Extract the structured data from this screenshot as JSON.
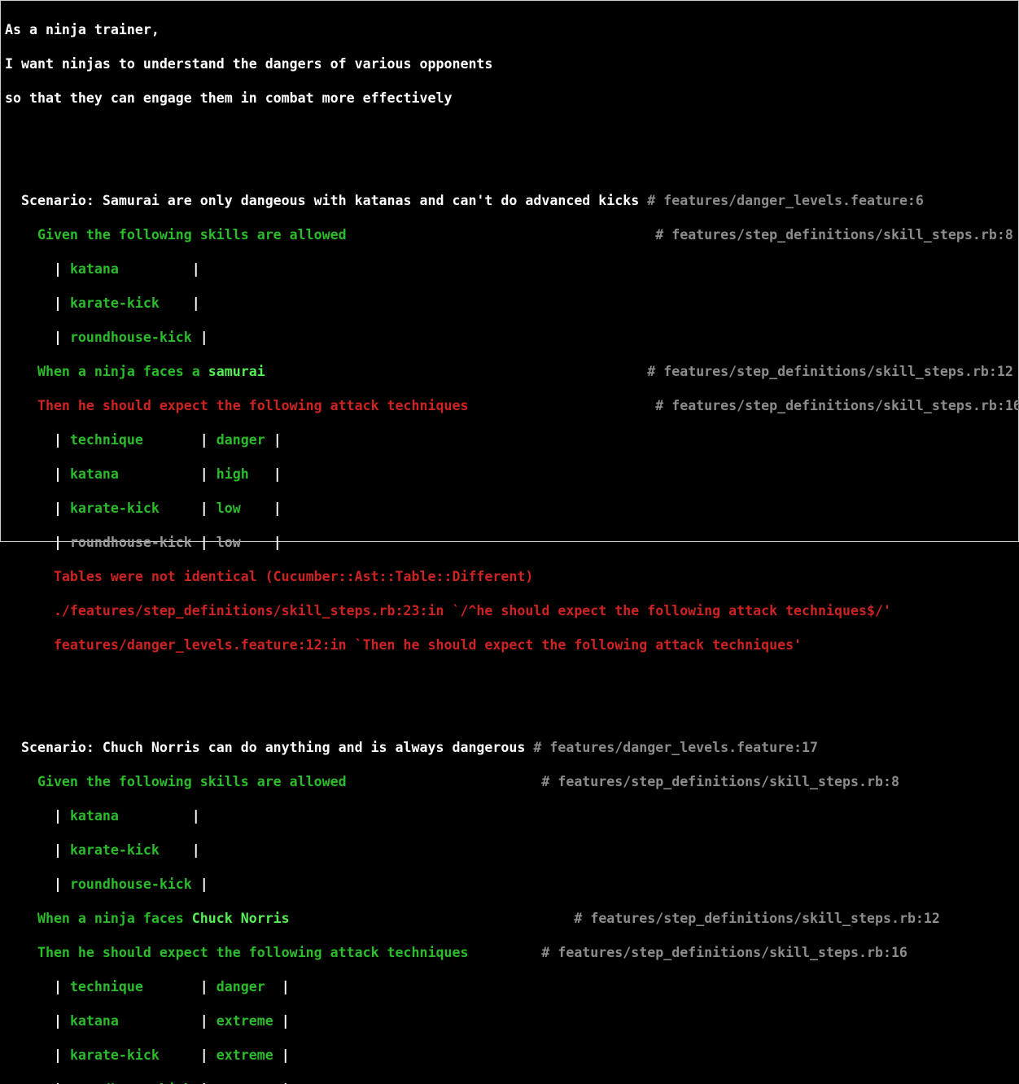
{
  "colors": {
    "background": "#000000",
    "text": "#ffffff",
    "passed": "#2bbb2b",
    "passed_arg": "#55ee55",
    "failed": "#cd2323",
    "comment": "#8c8c8c",
    "skipped": "#9a9a9a"
  },
  "feature": {
    "narrative": [
      "As a ninja trainer,",
      "I want ninjas to understand the dangers of various opponents",
      "so that they can engage them in combat more effectively"
    ]
  },
  "scenario1": {
    "title": "  Scenario: Samurai are only dangeous with katanas and can't do advanced kicks",
    "title_comment": " # features/danger_levels.feature:6",
    "given": "    Given the following skills are allowed                                      ",
    "given_comment": "# features/step_definitions/skill_steps.rb:8",
    "skills_table": [
      {
        "indent": "      ",
        "open": "| ",
        "cell": "katana        ",
        "close": " |"
      },
      {
        "indent": "      ",
        "open": "| ",
        "cell": "karate-kick   ",
        "close": " |"
      },
      {
        "indent": "      ",
        "open": "| ",
        "cell": "roundhouse-kick",
        "close": " |"
      }
    ],
    "when_prefix": "    When a ninja faces a ",
    "when_arg": "samurai",
    "when_pad": "                                               ",
    "when_comment": "# features/step_definitions/skill_steps.rb:12",
    "then": "    Then he should expect the following attack techniques                       ",
    "then_comment": "# features/step_definitions/skill_steps.rb:16",
    "techniques_table": [
      {
        "c1": "technique      ",
        "c2": "danger",
        "c2pad": " ",
        "skipped": false
      },
      {
        "c1": "katana         ",
        "c2": "high",
        "c2pad": "   ",
        "skipped": false
      },
      {
        "c1": "karate-kick    ",
        "c2": "low",
        "c2pad": "    ",
        "skipped": false
      },
      {
        "c1": "roundhouse-kick",
        "c2": "low",
        "c2pad": "    ",
        "skipped": true
      }
    ],
    "error_lines": [
      "      Tables were not identical (Cucumber::Ast::Table::Different)",
      "      ./features/step_definitions/skill_steps.rb:23:in `/^he should expect the following attack techniques$/'",
      "      features/danger_levels.feature:12:in `Then he should expect the following attack techniques'"
    ]
  },
  "scenario2": {
    "title": "  Scenario: Chuch Norris can do anything and is always dangerous",
    "title_comment": " # features/danger_levels.feature:17",
    "given": "    Given the following skills are allowed                        ",
    "given_comment": "# features/step_definitions/skill_steps.rb:8",
    "skills_table": [
      {
        "indent": "      ",
        "open": "| ",
        "cell": "katana        ",
        "close": " |"
      },
      {
        "indent": "      ",
        "open": "| ",
        "cell": "karate-kick   ",
        "close": " |"
      },
      {
        "indent": "      ",
        "open": "| ",
        "cell": "roundhouse-kick",
        "close": " |"
      }
    ],
    "when_prefix": "    When a ninja faces ",
    "when_arg": "Chuck Norris",
    "when_pad": "                                   ",
    "when_comment": "# features/step_definitions/skill_steps.rb:12",
    "then": "    Then he should expect the following attack techniques         ",
    "then_comment": "# features/step_definitions/skill_steps.rb:16",
    "techniques_table": [
      {
        "c1": "technique      ",
        "c2": "danger",
        "c2pad": "  "
      },
      {
        "c1": "katana         ",
        "c2": "extreme",
        "c2pad": " "
      },
      {
        "c1": "karate-kick    ",
        "c2": "extreme",
        "c2pad": " "
      },
      {
        "c1": "roundhouse-kick",
        "c2": "extreme",
        "c2pad": " "
      }
    ]
  }
}
